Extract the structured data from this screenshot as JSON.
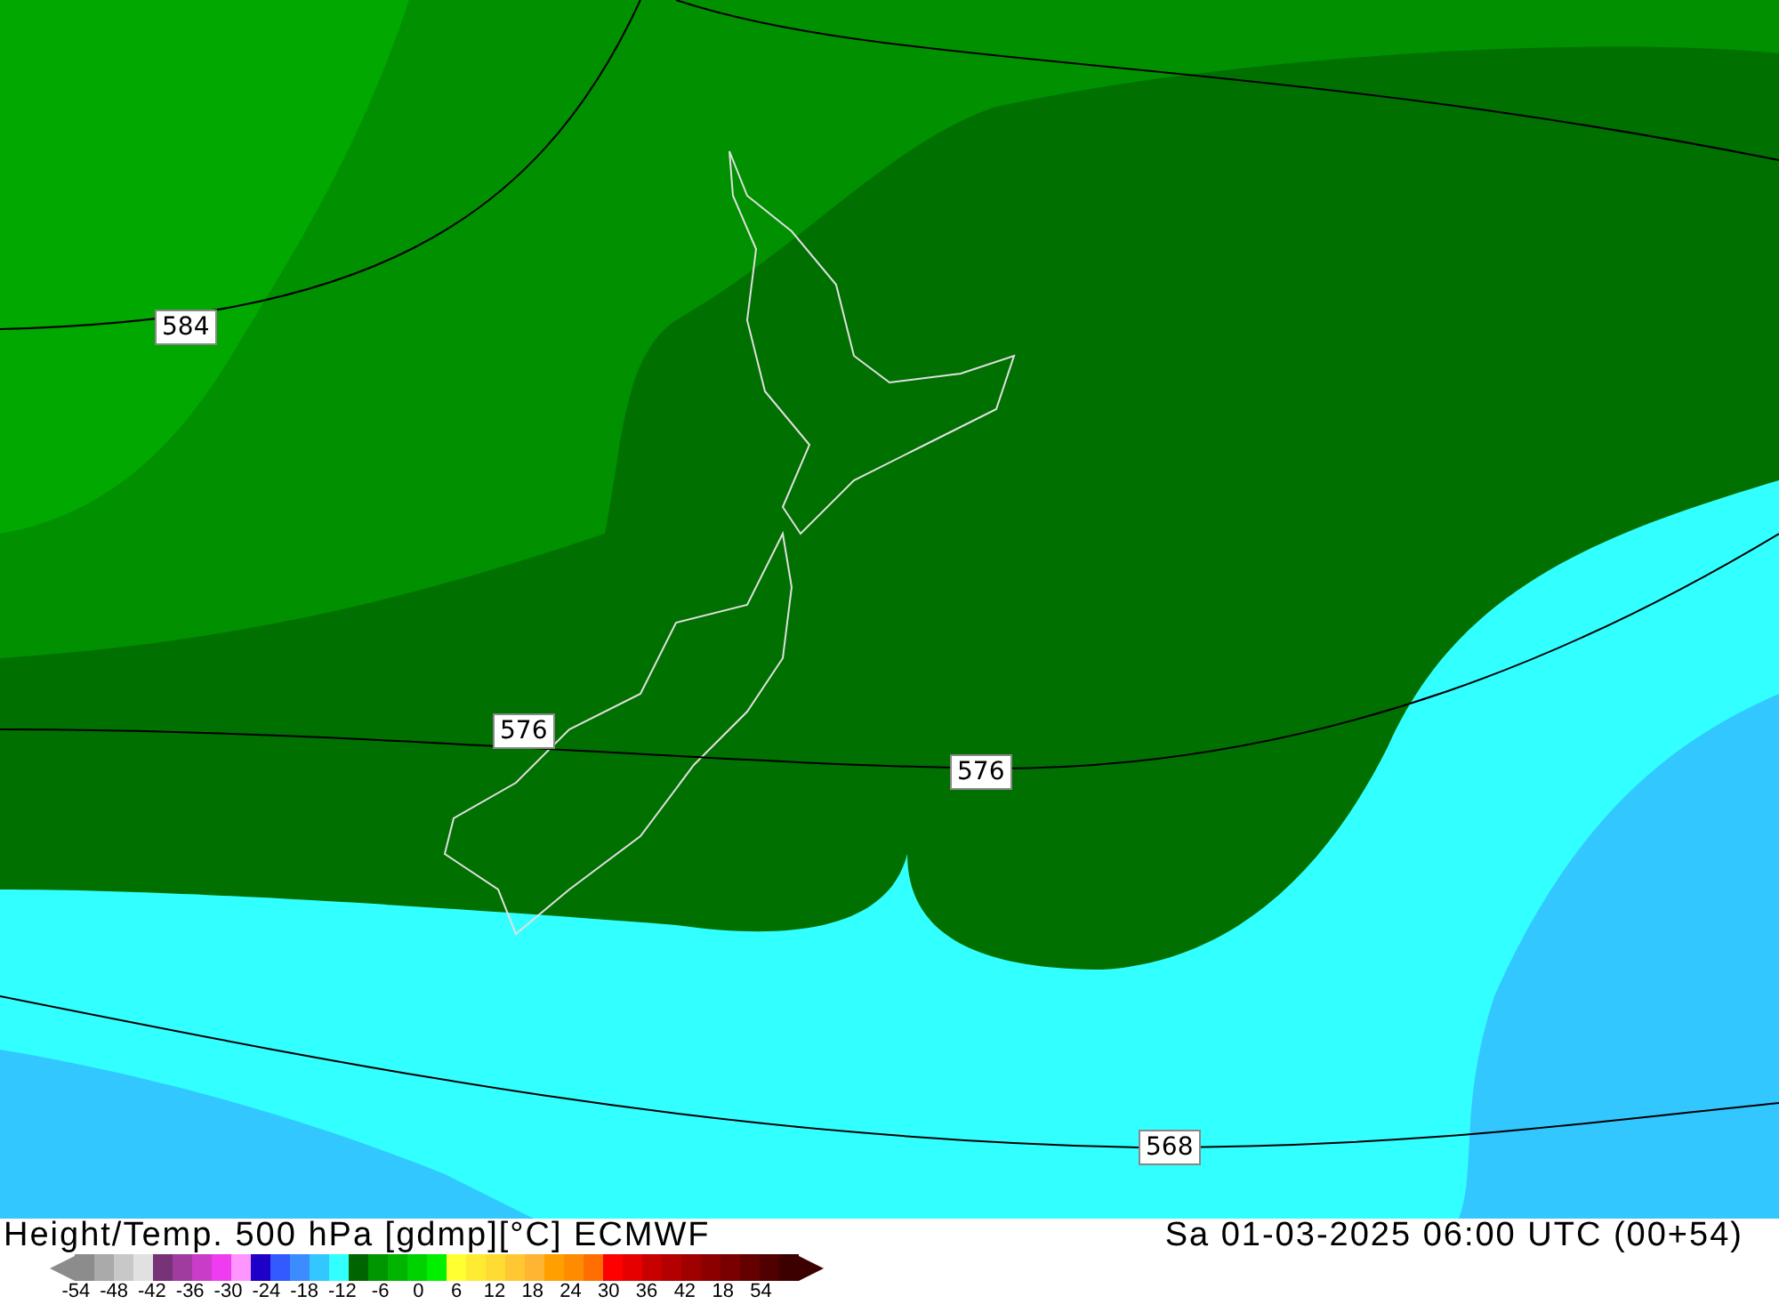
{
  "map": {
    "contour_labels": [
      {
        "text": "584",
        "kind": "left"
      },
      {
        "text": "576",
        "kind": "mid"
      },
      {
        "text": "576",
        "kind": "center"
      },
      {
        "text": "568",
        "kind": "low"
      }
    ]
  },
  "footer": {
    "title": "Height/Temp. 500 hPa [gdmp][°C] ECMWF",
    "valid_time": "Sa 01-03-2025 06:00 UTC (00+54)"
  },
  "legend": {
    "swatches": [
      {
        "color": "#8c8c8c"
      },
      {
        "color": "#aaaaaa"
      },
      {
        "color": "#c8c8c8"
      },
      {
        "color": "#e1e1e1"
      },
      {
        "color": "#783278"
      },
      {
        "color": "#a03ca0"
      },
      {
        "color": "#c83cc8"
      },
      {
        "color": "#f03cf0"
      },
      {
        "color": "#ff96ff"
      },
      {
        "color": "#1e00c8"
      },
      {
        "color": "#325aff"
      },
      {
        "color": "#3c8cff"
      },
      {
        "color": "#32c8ff"
      },
      {
        "color": "#32ffff"
      },
      {
        "color": "#006400"
      },
      {
        "color": "#009600"
      },
      {
        "color": "#00b400"
      },
      {
        "color": "#00d200"
      },
      {
        "color": "#00f000"
      },
      {
        "color": "#ffff32"
      },
      {
        "color": "#ffeb32"
      },
      {
        "color": "#ffdc32"
      },
      {
        "color": "#ffc832"
      },
      {
        "color": "#ffb432"
      },
      {
        "color": "#ffa000"
      },
      {
        "color": "#ff8c00"
      },
      {
        "color": "#ff6e00"
      },
      {
        "color": "#ff0000"
      },
      {
        "color": "#e60000"
      },
      {
        "color": "#c80000"
      },
      {
        "color": "#b40000"
      },
      {
        "color": "#a00000"
      },
      {
        "color": "#8c0000"
      },
      {
        "color": "#780000"
      },
      {
        "color": "#640000"
      },
      {
        "color": "#500000"
      },
      {
        "color": "#3c0000"
      }
    ],
    "ticks": [
      "-54",
      "-48",
      "-42",
      "-36",
      "-30",
      "-24",
      "-18",
      "-12",
      "-6",
      "0",
      "6",
      "12",
      "18",
      "24",
      "30",
      "36",
      "42",
      "18",
      "54"
    ]
  }
}
